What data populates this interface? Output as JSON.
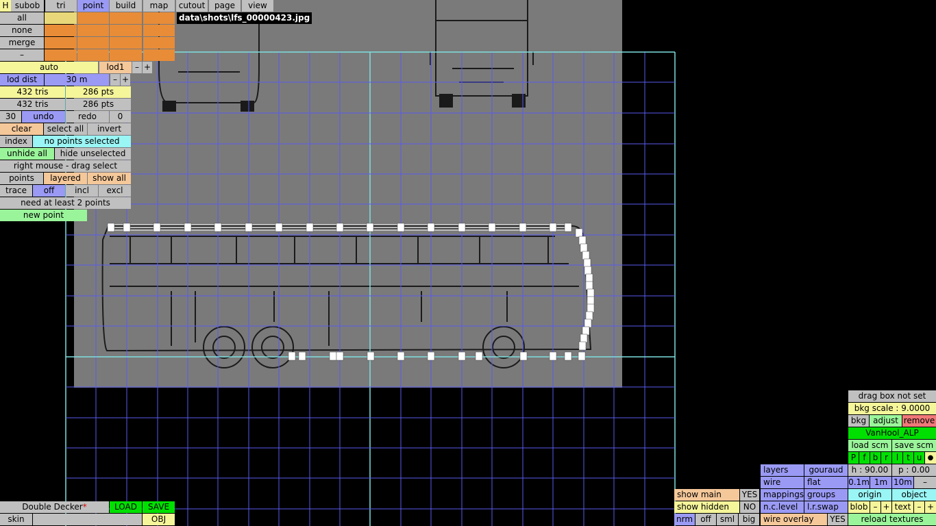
{
  "main_tabs": [
    {
      "label": "H"
    },
    {
      "label": "subob"
    },
    {
      "label": "tri"
    },
    {
      "label": "point"
    },
    {
      "label": "build"
    },
    {
      "label": "map"
    },
    {
      "label": "cutout"
    },
    {
      "label": "page"
    },
    {
      "label": "view"
    }
  ],
  "image_path": "data\\shots\\lfs_00000423.jpg",
  "selection": {
    "all": "all",
    "none": "none",
    "merge": "merge",
    "minus": "–"
  },
  "lod": {
    "auto": "auto",
    "level": "lod1",
    "minus": "–",
    "plus": "+",
    "dist_label": "lod dist",
    "dist_value": "30 m"
  },
  "stats": {
    "tris1": "432 tris",
    "pts1": "286 pts",
    "tris2": "432 tris",
    "pts2": "286 pts"
  },
  "history": {
    "undo_count": "30",
    "undo": "undo",
    "redo": "redo",
    "redo_count": "0"
  },
  "sel_ops": {
    "clear": "clear",
    "select_all": "select all",
    "invert": "invert"
  },
  "index": {
    "label": "index",
    "status": "no points selected"
  },
  "hide": {
    "unhide_all": "unhide all",
    "hide_unselected": "hide unselected"
  },
  "hint_drag": "right mouse - drag select",
  "points_row": {
    "points": "points",
    "layered": "layered",
    "show_all": "show all"
  },
  "trace_row": {
    "trace": "trace",
    "off": "off",
    "incl": "incl",
    "excl": "excl"
  },
  "need_points": "need at least 2 points",
  "new_point": "new point",
  "object": {
    "name": "Double Decker",
    "modified": "*",
    "load": "LOAD",
    "save": "SAVE",
    "skin_label": "skin",
    "skin_value": "",
    "obj": "OBJ"
  },
  "right_panel": {
    "drag_box": "drag box not set",
    "bkg_scale": "bkg scale : 9.0000",
    "bkg": "bkg",
    "adjust": "adjust",
    "remove": "remove",
    "model": "VanHool_ALP",
    "load_scm": "load scm",
    "save_scm": "save scm",
    "views": [
      "P",
      "f",
      "b",
      "r",
      "l",
      "t",
      "u"
    ],
    "dot": "●",
    "h_val": "h : 90.00",
    "p_val": "p : 0.00",
    "s01": "0.1m",
    "s1": "1m",
    "s10": "10m",
    "sminus": "–",
    "origin": "origin",
    "object": "object",
    "blob": "blob",
    "blob_minus": "–",
    "blob_plus": "+",
    "text": "text",
    "text_minus": "–",
    "text_plus": "+",
    "reload": "reload textures"
  },
  "render_panel": {
    "layers": "layers",
    "gouraud": "gouraud",
    "wire": "wire",
    "flat": "flat",
    "mappings": "mappings",
    "groups": "groups",
    "nclevel": "n.c.level",
    "lrswap": "l.r.swap",
    "wire_overlay": "wire overlay",
    "wire_overlay_val": "YES"
  },
  "show_panel": {
    "show_main": "show main",
    "show_main_val": "YES",
    "show_hidden": "show hidden",
    "show_hidden_val": "NO",
    "nrm": "nrm",
    "off": "off",
    "sml": "sml",
    "big": "big"
  },
  "colors": {
    "grid": "#5a5af0",
    "grid_axis": "#7ee0e0",
    "background_image": "#7a7a7a",
    "selected_tab": "#9a9af5",
    "accent_orange": "#e88c38",
    "accent_green": "#00e000"
  }
}
